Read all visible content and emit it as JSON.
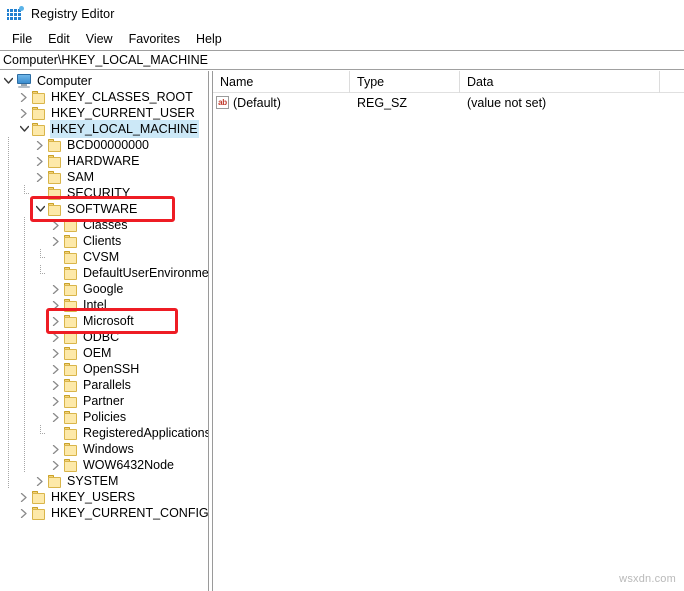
{
  "window": {
    "title": "Registry Editor",
    "icon": "registry-editor-icon"
  },
  "menubar": {
    "items": [
      {
        "label": "File"
      },
      {
        "label": "Edit"
      },
      {
        "label": "View"
      },
      {
        "label": "Favorites"
      },
      {
        "label": "Help"
      }
    ]
  },
  "address": {
    "path": "Computer\\HKEY_LOCAL_MACHINE"
  },
  "tree": {
    "nodes": [
      {
        "label": "Computer",
        "depth": 0,
        "icon": "computer-icon",
        "expander": "expanded",
        "selected": false
      },
      {
        "label": "HKEY_CLASSES_ROOT",
        "depth": 1,
        "icon": "folder-icon",
        "expander": "collapsed",
        "selected": false
      },
      {
        "label": "HKEY_CURRENT_USER",
        "depth": 1,
        "icon": "folder-icon",
        "expander": "collapsed",
        "selected": false
      },
      {
        "label": "HKEY_LOCAL_MACHINE",
        "depth": 1,
        "icon": "folder-icon",
        "expander": "expanded",
        "selected": true
      },
      {
        "label": "BCD00000000",
        "depth": 2,
        "icon": "folder-icon",
        "expander": "collapsed",
        "selected": false
      },
      {
        "label": "HARDWARE",
        "depth": 2,
        "icon": "folder-icon",
        "expander": "collapsed",
        "selected": false
      },
      {
        "label": "SAM",
        "depth": 2,
        "icon": "folder-icon",
        "expander": "collapsed",
        "selected": false
      },
      {
        "label": "SECURITY",
        "depth": 2,
        "icon": "folder-icon",
        "expander": "leaf",
        "selected": false
      },
      {
        "label": "SOFTWARE",
        "depth": 2,
        "icon": "folder-icon",
        "expander": "expanded",
        "selected": false
      },
      {
        "label": "Classes",
        "depth": 3,
        "icon": "folder-icon",
        "expander": "collapsed",
        "selected": false
      },
      {
        "label": "Clients",
        "depth": 3,
        "icon": "folder-icon",
        "expander": "collapsed",
        "selected": false
      },
      {
        "label": "CVSM",
        "depth": 3,
        "icon": "folder-icon",
        "expander": "leaf",
        "selected": false
      },
      {
        "label": "DefaultUserEnvironmen",
        "depth": 3,
        "icon": "folder-icon",
        "expander": "leaf",
        "selected": false
      },
      {
        "label": "Google",
        "depth": 3,
        "icon": "folder-icon",
        "expander": "collapsed",
        "selected": false
      },
      {
        "label": "Intel",
        "depth": 3,
        "icon": "folder-icon",
        "expander": "collapsed",
        "selected": false
      },
      {
        "label": "Microsoft",
        "depth": 3,
        "icon": "folder-icon",
        "expander": "collapsed",
        "selected": false
      },
      {
        "label": "ODBC",
        "depth": 3,
        "icon": "folder-icon",
        "expander": "collapsed",
        "selected": false
      },
      {
        "label": "OEM",
        "depth": 3,
        "icon": "folder-icon",
        "expander": "collapsed",
        "selected": false
      },
      {
        "label": "OpenSSH",
        "depth": 3,
        "icon": "folder-icon",
        "expander": "collapsed",
        "selected": false
      },
      {
        "label": "Parallels",
        "depth": 3,
        "icon": "folder-icon",
        "expander": "collapsed",
        "selected": false
      },
      {
        "label": "Partner",
        "depth": 3,
        "icon": "folder-icon",
        "expander": "collapsed",
        "selected": false
      },
      {
        "label": "Policies",
        "depth": 3,
        "icon": "folder-icon",
        "expander": "collapsed",
        "selected": false
      },
      {
        "label": "RegisteredApplications",
        "depth": 3,
        "icon": "folder-icon",
        "expander": "leaf",
        "selected": false
      },
      {
        "label": "Windows",
        "depth": 3,
        "icon": "folder-icon",
        "expander": "collapsed",
        "selected": false
      },
      {
        "label": "WOW6432Node",
        "depth": 3,
        "icon": "folder-icon",
        "expander": "collapsed",
        "selected": false
      },
      {
        "label": "SYSTEM",
        "depth": 2,
        "icon": "folder-icon",
        "expander": "collapsed",
        "selected": false
      },
      {
        "label": "HKEY_USERS",
        "depth": 1,
        "icon": "folder-icon",
        "expander": "collapsed",
        "selected": false
      },
      {
        "label": "HKEY_CURRENT_CONFIG",
        "depth": 1,
        "icon": "folder-icon",
        "expander": "collapsed",
        "selected": false
      }
    ]
  },
  "values": {
    "columns": [
      "Name",
      "Type",
      "Data"
    ],
    "rows": [
      {
        "name": "(Default)",
        "type": "REG_SZ",
        "data": "(value not set)",
        "icon": "string-value-icon"
      }
    ]
  },
  "annotations": [
    {
      "target": "SOFTWARE",
      "color": "#ee1c24"
    },
    {
      "target": "Microsoft",
      "color": "#ee1c24"
    }
  ],
  "watermark": {
    "text": "wsxdn.com"
  }
}
